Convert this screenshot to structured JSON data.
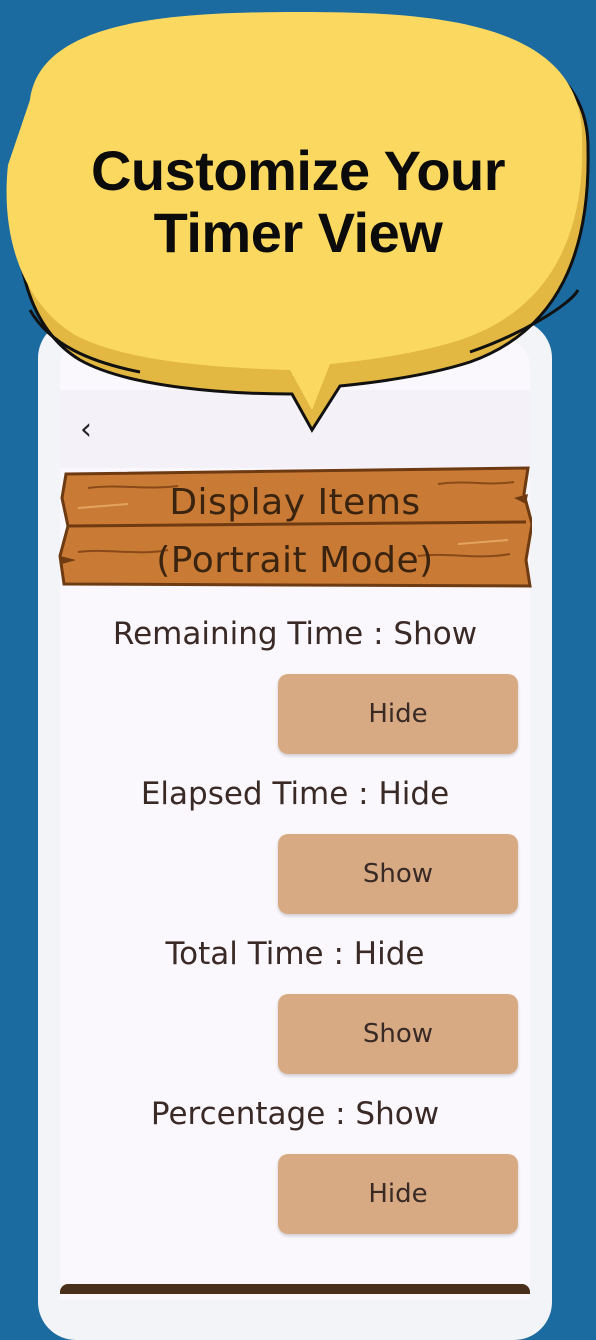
{
  "banner": {
    "headline_line1": "Customize Your",
    "headline_line2": "Timer View"
  },
  "nav": {
    "back_glyph": "‹",
    "back_icon": "chevron-left-icon"
  },
  "sign": {
    "line1": "Display Items",
    "line2": "(Portrait Mode)"
  },
  "settings": [
    {
      "label": "Remaining Time : Show",
      "button": "Hide"
    },
    {
      "label": "Elapsed Time : Hide",
      "button": "Show"
    },
    {
      "label": "Total Time : Hide",
      "button": "Show"
    },
    {
      "label": "Percentage : Show",
      "button": "Hide"
    }
  ],
  "colors": {
    "background": "#1b6aa0",
    "bubble": "#fbd961",
    "bubble_shadow": "#e3b842",
    "wood": "#c97a34",
    "button": "#d8aa83",
    "text": "#3a2a26"
  }
}
